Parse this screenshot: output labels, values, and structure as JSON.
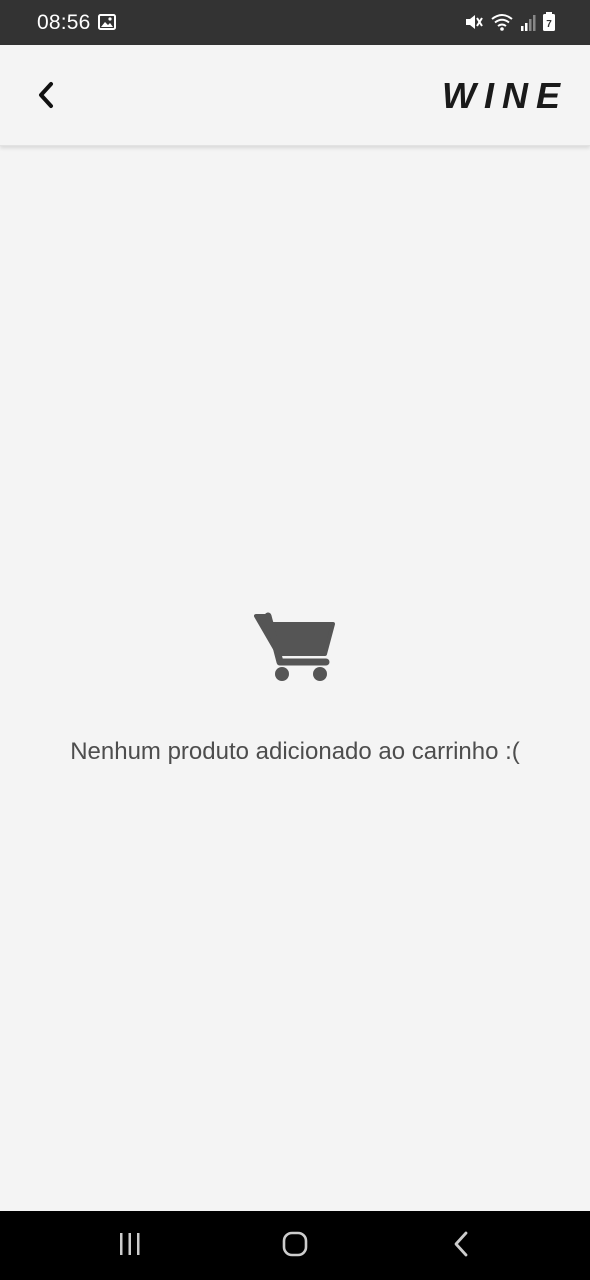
{
  "status_bar": {
    "time": "08:56",
    "battery_level": "7",
    "icons": [
      "gallery-icon",
      "mute-icon",
      "wifi-icon",
      "signal-icon",
      "battery-icon"
    ]
  },
  "app_bar": {
    "logo": "WINE",
    "back_icon": "chevron-left-icon"
  },
  "empty_state": {
    "icon": "shopping-cart-icon",
    "message": "Nenhum produto adicionado ao carrinho :("
  },
  "nav_bar": {
    "buttons": [
      "recents",
      "home",
      "back"
    ]
  },
  "colors": {
    "status_bar_bg": "#333333",
    "background": "#f4f4f4",
    "icon_gray": "#555555",
    "text_gray": "#4d4d4d",
    "nav_bar_bg": "#000000"
  }
}
